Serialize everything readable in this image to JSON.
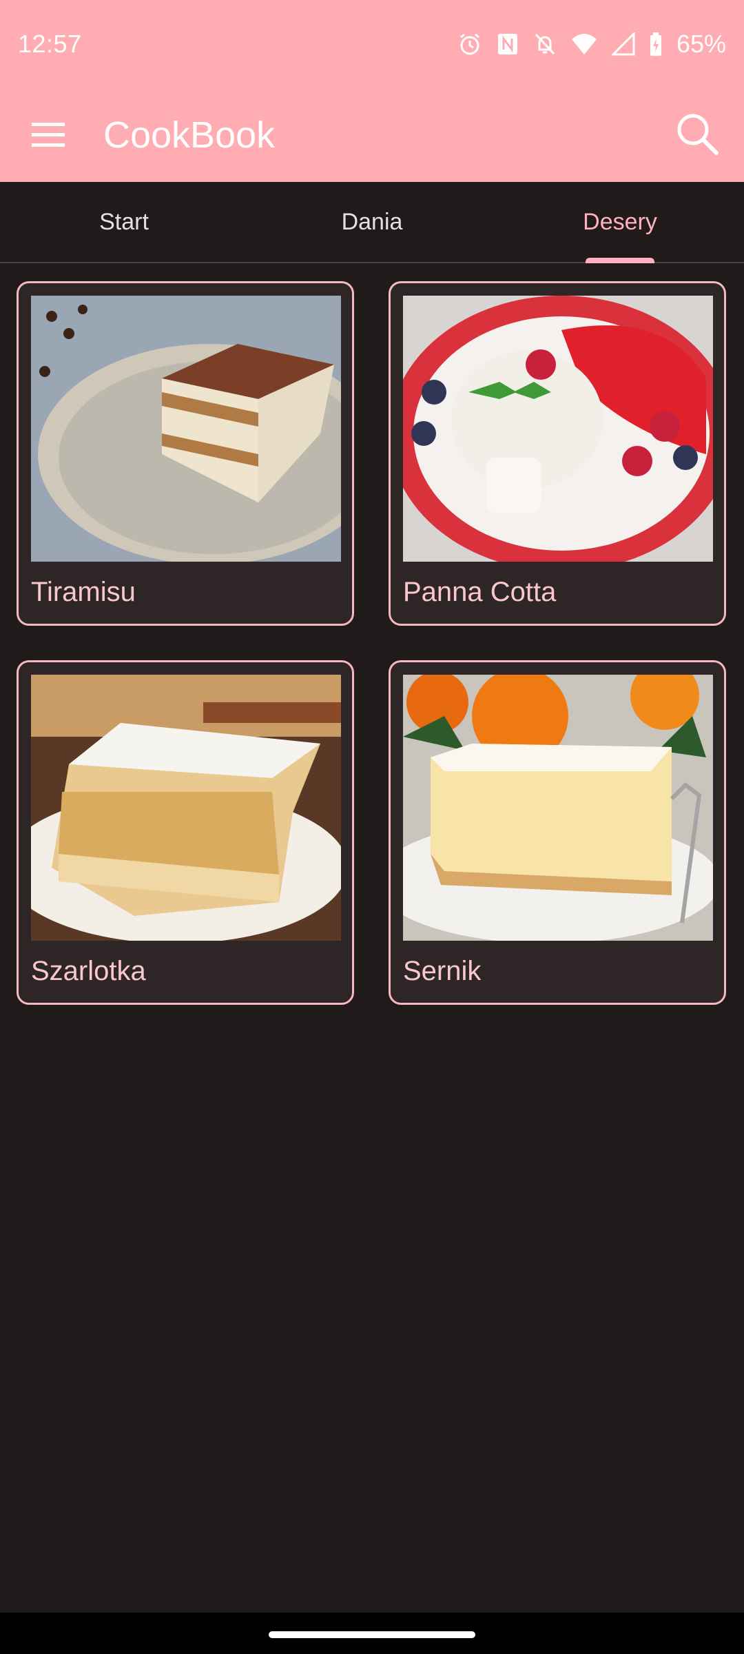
{
  "status_bar": {
    "time": "12:57",
    "battery": "65%",
    "icons": [
      "alarm-icon",
      "nfc-icon",
      "bell-off-icon",
      "wifi-icon",
      "signal-icon",
      "battery-icon"
    ]
  },
  "app_bar": {
    "title": "CookBook",
    "menu_icon": "menu-icon",
    "search_icon": "search-icon"
  },
  "tabs": [
    {
      "label": "Start",
      "selected": false
    },
    {
      "label": "Dania",
      "selected": false
    },
    {
      "label": "Desery",
      "selected": true
    }
  ],
  "recipes": [
    {
      "title": "Tiramisu"
    },
    {
      "title": "Panna Cotta"
    },
    {
      "title": "Szarlotka"
    },
    {
      "title": "Sernik"
    }
  ],
  "colors": {
    "primary": "#ffadb2",
    "background": "#201a1b",
    "accent": "#ffb1c0",
    "card_border": "#f6b8c3"
  }
}
